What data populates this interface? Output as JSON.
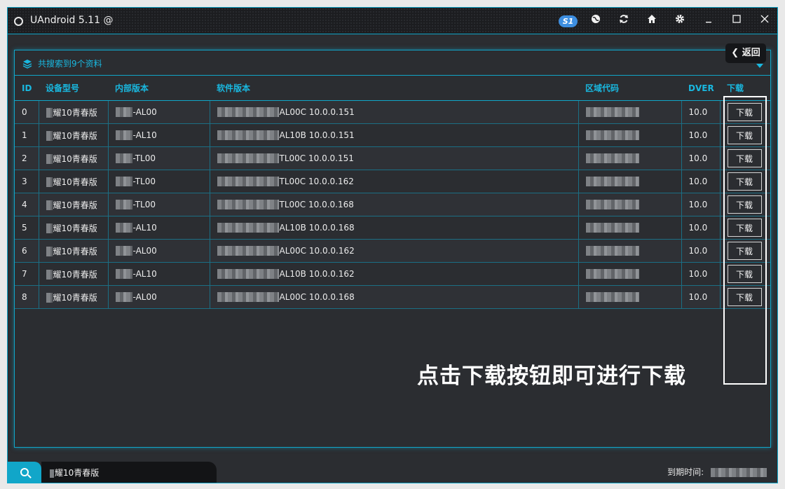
{
  "window": {
    "title": "UAndroid 5.11 @",
    "badge": "S1",
    "icons": [
      "globe-icon",
      "refresh-icon",
      "home-icon",
      "gear-icon",
      "minimize-icon",
      "maximize-icon",
      "close-icon"
    ]
  },
  "panel": {
    "title": "共搜索到9个资料",
    "back_label": "返回"
  },
  "table": {
    "headers": [
      "ID",
      "设备型号",
      "内部版本",
      "软件版本",
      "区域代码",
      "DVER",
      "下载"
    ],
    "button_label": "下载",
    "rows": [
      {
        "id": "0",
        "device": "耀10青春版",
        "internal": "-AL00",
        "software": "AL00C 10.0.0.151",
        "dver": "10.0"
      },
      {
        "id": "1",
        "device": "耀10青春版",
        "internal": "-AL10",
        "software": "AL10B 10.0.0.151",
        "dver": "10.0"
      },
      {
        "id": "2",
        "device": "耀10青春版",
        "internal": "-TL00",
        "software": "TL00C 10.0.0.151",
        "dver": "10.0"
      },
      {
        "id": "3",
        "device": "耀10青春版",
        "internal": "-TL00",
        "software": "TL00C 10.0.0.162",
        "dver": "10.0"
      },
      {
        "id": "4",
        "device": "耀10青春版",
        "internal": "-TL00",
        "software": "TL00C 10.0.0.168",
        "dver": "10.0"
      },
      {
        "id": "5",
        "device": "耀10青春版",
        "internal": "-AL10",
        "software": "AL10B 10.0.0.168",
        "dver": "10.0"
      },
      {
        "id": "6",
        "device": "耀10青春版",
        "internal": "-AL00",
        "software": "AL00C 10.0.0.162",
        "dver": "10.0"
      },
      {
        "id": "7",
        "device": "耀10青春版",
        "internal": "-AL10",
        "software": "AL10B 10.0.0.162",
        "dver": "10.0"
      },
      {
        "id": "8",
        "device": "耀10青春版",
        "internal": "-AL00",
        "software": "AL00C 10.0.0.168",
        "dver": "10.0"
      }
    ]
  },
  "annotation": "点击下载按钮即可进行下载",
  "bottom": {
    "search_value": "耀10青春版",
    "expire_label": "到期时间:"
  },
  "colors": {
    "accent": "#11a6c9",
    "header_text": "#19b8e0",
    "background": "#2b2d31",
    "titlebar": "#1c1d20",
    "badge": "#3d8ee0"
  }
}
